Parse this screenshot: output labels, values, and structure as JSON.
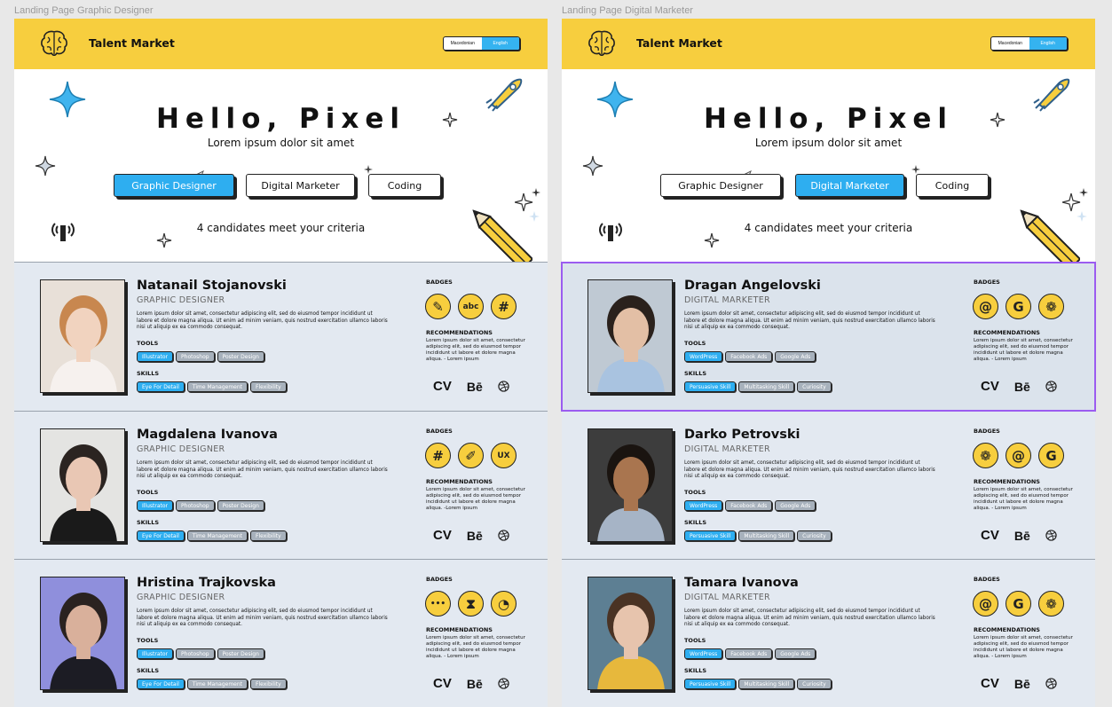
{
  "frames": [
    {
      "label": "Landing Page Graphic Designer",
      "brand": "Talent Market",
      "lang": {
        "left": "Macedonian",
        "right": "English"
      },
      "hero": {
        "title": "Hello, Pixel",
        "subtitle": "Lorem ipsum dolor sit amet",
        "count": "4 candidates meet your criteria"
      },
      "categories": [
        {
          "label": "Graphic Designer",
          "active": true
        },
        {
          "label": "Digital Marketer",
          "active": false
        },
        {
          "label": "Coding",
          "active": false
        }
      ],
      "cards": [
        {
          "name": "Natanail Stojanovski",
          "role": "GRAPHIC DESIGNER",
          "desc": "Lorem ipsum dolor sit amet, consectetur adipiscing elit, sed do eiusmod tempor incididunt ut labore et dolore magna aliqua. Ut enim ad minim veniam, quis nostrud exercitation ullamco laboris nisi ut aliquip ex ea commodo consequat.",
          "tools_label": "TOOLS",
          "tools": [
            "Illustrator",
            "Photoshop",
            "Poster Design"
          ],
          "skills_label": "SKILLS",
          "skills": [
            "Eye For Detail",
            "Time Management",
            "Flexibility"
          ],
          "badges_label": "BADGES",
          "badges": [
            "pencil-ruler-icon",
            "abc-icon",
            "slack-icon"
          ],
          "rec_label": "RECOMMENDATIONS",
          "rec": "Lorem ipsum dolor sit amet, consectetur adipiscing elit, sed do eiusmod tempor incididunt ut labore et dolore magna aliqua. - Lorem ipsum",
          "links": {
            "cv": "CV",
            "be": "Bē"
          }
        },
        {
          "name": "Magdalena Ivanova",
          "role": "GRAPHIC DESIGNER",
          "desc": "Lorem ipsum dolor sit amet, consectetur adipiscing elit, sed do eiusmod tempor incididunt ut labore et dolore magna aliqua. Ut enim ad minim veniam, quis nostrud exercitation ullamco laboris nisi ut aliquip ex ea commodo consequat.",
          "tools_label": "TOOLS",
          "tools": [
            "Illustrator",
            "Photoshop",
            "Poster Design"
          ],
          "skills_label": "SKILLS",
          "skills": [
            "Eye For Detail",
            "Time Management",
            "Flexibility"
          ],
          "badges_label": "BADGES",
          "badges": [
            "slack-icon",
            "brush-icon",
            "ux-icon"
          ],
          "rec_label": "RECOMMENDATIONS",
          "rec": "Lorem ipsum dolor sit amet, consectetur adipiscing elit, sed do eiusmod tempor incididunt ut labore et dolore magna aliqua. -Lorem ipsum",
          "links": {
            "cv": "CV",
            "be": "Bē"
          }
        },
        {
          "name": "Hristina Trajkovska",
          "role": "GRAPHIC DESIGNER",
          "desc": "Lorem ipsum dolor sit amet, consectetur adipiscing elit, sed do eiusmod tempor incididunt ut labore et dolore magna aliqua. Ut enim ad minim veniam, quis nostrud exercitation ullamco laboris nisi ut aliquip ex ea commodo consequat.",
          "tools_label": "TOOLS",
          "tools": [
            "Illustrator",
            "Photoshop",
            "Poster Design"
          ],
          "skills_label": "SKILLS",
          "skills": [
            "Eye For Detail",
            "Time Management",
            "Flexibility"
          ],
          "badges_label": "BADGES",
          "badges": [
            "chat-icon",
            "hourglass-icon",
            "clock-icon"
          ],
          "rec_label": "RECOMMENDATIONS",
          "rec": "Lorem ipsum dolor sit amet, consectetur adipiscing elit, sed do eiusmod tempor incididunt ut labore et dolore magna aliqua. - Lorem ipsum",
          "links": {
            "cv": "CV",
            "be": "Bē"
          }
        }
      ]
    },
    {
      "label": "Landing Page Digital Marketer",
      "brand": "Talent Market",
      "lang": {
        "left": "Macedonian",
        "right": "English"
      },
      "hero": {
        "title": "Hello, Pixel",
        "subtitle": "Lorem ipsum dolor sit amet",
        "count": "4 candidates meet your criteria"
      },
      "categories": [
        {
          "label": "Graphic Designer",
          "active": false
        },
        {
          "label": "Digital Marketer",
          "active": true
        },
        {
          "label": "Coding",
          "active": false
        }
      ],
      "cards": [
        {
          "name": "Dragan Angelovski",
          "role": "DIGITAL MARKETER",
          "desc": "Lorem ipsum dolor sit amet, consectetur adipiscing elit, sed do eiusmod tempor incididunt ut labore et dolore magna aliqua. Ut enim ad minim veniam, quis nostrud exercitation ullamco laboris nisi ut aliquip ex ea commodo consequat.",
          "tools_label": "TOOLS",
          "tools": [
            "WordPress",
            "Facebook Ads",
            "Google Ads"
          ],
          "skills_label": "SKILLS",
          "skills": [
            "Persuasive Skill",
            "Multitasking Skill",
            "Curiosity"
          ],
          "badges_label": "BADGES",
          "badges": [
            "at-icon",
            "google-icon",
            "paw-icon"
          ],
          "rec_label": "RECOMMENDATIONS",
          "rec": "Lorem ipsum dolor sit amet, consectetur adipiscing elit, sed do eiusmod tempor incididunt ut labore et dolore magna aliqua. - Lorem ipsum",
          "links": {
            "cv": "CV",
            "be": "Bē"
          }
        },
        {
          "name": "Darko Petrovski",
          "role": "DIGITAL MARKETER",
          "desc": "Lorem ipsum dolor sit amet, consectetur adipiscing elit, sed do eiusmod tempor incididunt ut labore et dolore magna aliqua. Ut enim ad minim veniam, quis nostrud exercitation ullamco laboris nisi ut aliquip ex ea commodo consequat.",
          "tools_label": "TOOLS",
          "tools": [
            "WordPress",
            "Facebook Ads",
            "Google Ads"
          ],
          "skills_label": "SKILLS",
          "skills": [
            "Persuasive Skill",
            "Multitasking Skill",
            "Curiosity"
          ],
          "badges_label": "BADGES",
          "badges": [
            "paw-icon",
            "at-icon",
            "google-icon"
          ],
          "rec_label": "RECOMMENDATIONS",
          "rec": "Lorem ipsum dolor sit amet, consectetur adipiscing elit, sed do eiusmod tempor incididunt ut labore et dolore magna aliqua. - Lorem ipsum",
          "links": {
            "cv": "CV",
            "be": "Bē"
          }
        },
        {
          "name": "Tamara Ivanova",
          "role": "DIGITAL MARKETER",
          "desc": "Lorem ipsum dolor sit amet, consectetur adipiscing elit, sed do eiusmod tempor incididunt ut labore et dolore magna aliqua. Ut enim ad minim veniam, quis nostrud exercitation ullamco laboris nisi ut aliquip ex ea commodo consequat.",
          "tools_label": "TOOLS",
          "tools": [
            "WordPress",
            "Facebook Ads",
            "Google Ads"
          ],
          "skills_label": "SKILLS",
          "skills": [
            "Persuasive Skill",
            "Multitasking Skill",
            "Curiosity"
          ],
          "badges_label": "BADGES",
          "badges": [
            "at-icon",
            "google-icon",
            "paw-icon"
          ],
          "rec_label": "RECOMMENDATIONS",
          "rec": "Lorem ipsum dolor sit amet, consectetur adipiscing elit, sed do eiusmod tempor incididunt ut labore et dolore magna aliqua. - Lorem ipsum",
          "links": {
            "cv": "CV",
            "be": "Bē"
          }
        }
      ]
    }
  ],
  "colors": {
    "brand_yellow": "#f7ce3e",
    "accent_blue": "#2eaef0",
    "card_bg": "#e3e9f1",
    "selection": "#9b5cf0"
  }
}
